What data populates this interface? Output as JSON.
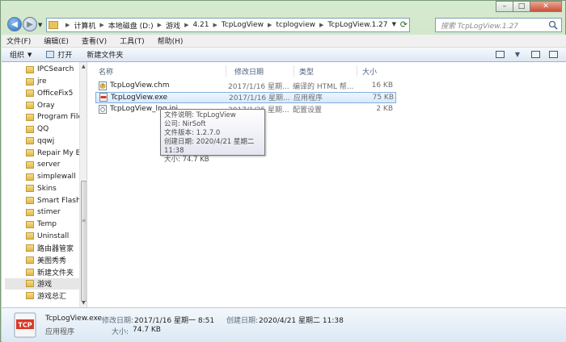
{
  "window": {
    "buttons": {
      "minimize": "–",
      "maximize": "□",
      "close": "✕"
    }
  },
  "address": {
    "crumbs": [
      "计算机",
      "本地磁盘 (D:)",
      "游戏",
      "4.21",
      "TcpLogView",
      "tcplogview",
      "TcpLogView.1.27"
    ]
  },
  "search": {
    "placeholder": "搜索 TcpLogView.1.27"
  },
  "menu": [
    "文件(F)",
    "编辑(E)",
    "查看(V)",
    "工具(T)",
    "帮助(H)"
  ],
  "commands": {
    "organize": "组织",
    "open": "打开",
    "new_folder": "新建文件夹"
  },
  "nav_items": [
    {
      "label": "IPCSearch",
      "selected": false
    },
    {
      "label": "jre",
      "selected": false
    },
    {
      "label": "OfficeFix5",
      "selected": false
    },
    {
      "label": "Oray",
      "selected": false
    },
    {
      "label": "Program Files",
      "selected": false
    },
    {
      "label": "QQ",
      "selected": false
    },
    {
      "label": "qqwj",
      "selected": false
    },
    {
      "label": "Repair My Exc",
      "selected": false
    },
    {
      "label": "server",
      "selected": false
    },
    {
      "label": "simplewall",
      "selected": false
    },
    {
      "label": "Skins",
      "selected": false
    },
    {
      "label": "Smart Flash R",
      "selected": false
    },
    {
      "label": "stimer",
      "selected": false
    },
    {
      "label": "Temp",
      "selected": false
    },
    {
      "label": "Uninstall",
      "selected": false
    },
    {
      "label": "路由器管家",
      "selected": false
    },
    {
      "label": "美图秀秀",
      "selected": false
    },
    {
      "label": "新建文件夹",
      "selected": false
    },
    {
      "label": "游戏",
      "selected": true
    },
    {
      "label": "游戏总汇",
      "selected": false
    }
  ],
  "columns": {
    "name": "名称",
    "date": "修改日期",
    "type": "类型",
    "size": "大小"
  },
  "files": [
    {
      "name": "TcpLogView.chm",
      "date": "2017/1/16 星期...",
      "type": "编译的 HTML 帮...",
      "size": "16 KB",
      "icon": "chm-icon",
      "selected": false
    },
    {
      "name": "TcpLogView.exe",
      "date": "2017/1/16 星期...",
      "type": "应用程序",
      "size": "75 KB",
      "icon": "exe-icon",
      "selected": true
    },
    {
      "name": "TcpLogView_lng.ini",
      "date": "2017/1/25 星期...",
      "type": "配置设置",
      "size": "2 KB",
      "icon": "ini-icon",
      "selected": false
    }
  ],
  "tooltip": [
    "文件说明: TcpLogView",
    "公司: NirSoft",
    "文件版本: 1.2.7.0",
    "创建日期: 2020/4/21 星期二 11:38",
    "大小: 74.7 KB"
  ],
  "details": {
    "name": "TcpLogView.exe",
    "kind": "应用程序",
    "modified_label": "修改日期:",
    "modified_value": "2017/1/16 星期一 8:51",
    "created_label": "创建日期:",
    "created_value": "2020/4/21 星期二 11:38",
    "size_label": "大小:",
    "size_value": "74.7 KB",
    "icon_text": "TCP"
  }
}
